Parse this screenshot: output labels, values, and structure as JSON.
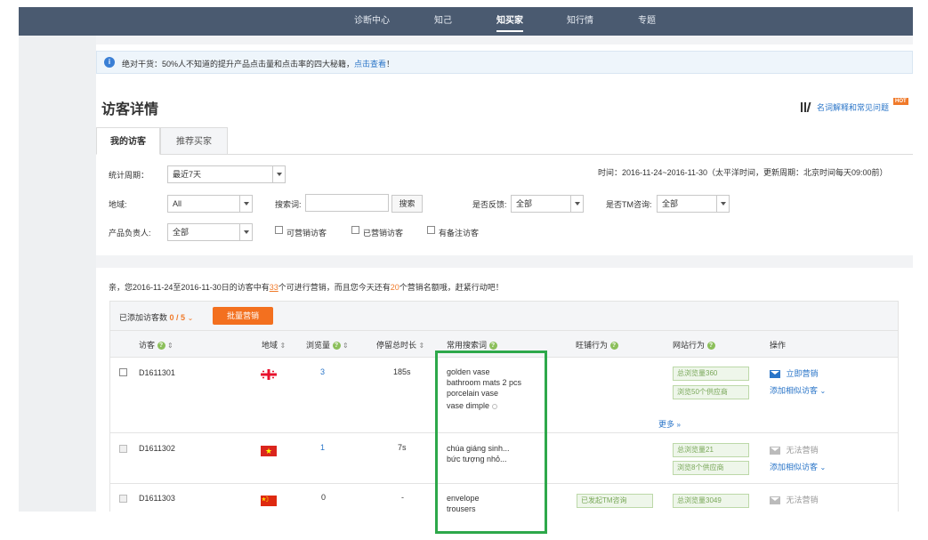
{
  "nav": {
    "items": [
      {
        "label": "诊断中心"
      },
      {
        "label": "知己"
      },
      {
        "label": "知买家",
        "active": true
      },
      {
        "label": "知行情"
      },
      {
        "label": "专题"
      }
    ]
  },
  "notice": {
    "icon": "info-icon",
    "text": "绝对干货：50%人不知道的提升产品点击量和点击率的四大秘籍，",
    "link": "点击查看",
    "suffix": "！"
  },
  "page": {
    "title": "访客详情",
    "help_label": "名词解释和常见问题",
    "hot_badge": "HOT"
  },
  "tabs": [
    {
      "label": "我的访客",
      "active": true
    },
    {
      "label": "推荐买家",
      "active": false
    }
  ],
  "filters": {
    "period_label": "统计周期：",
    "period_value": "最近7天",
    "time_text": "时间：2016-11-24~2016-11-30（太平洋时间，更新周期：北京时间每天09:00前）",
    "region_label": "地域:",
    "region_value": "All",
    "search_label": "搜索词:",
    "search_value": "",
    "search_button": "搜索",
    "feedback_label": "是否反馈:",
    "feedback_value": "全部",
    "tm_label": "是否TM咨询:",
    "tm_value": "全部",
    "owner_label": "产品负责人:",
    "owner_value": "全部",
    "checkbox_marketable": "可营销访客",
    "checkbox_marketed": "已营销访客",
    "checkbox_remark": "有备注访客"
  },
  "summary": {
    "prefix": "亲，您2016-11-24至2016-11-30日的访客中有",
    "count": "33",
    "middle": "个可进行营销，而且您今天还有",
    "quota": "20",
    "suffix": "个营销名额哦，赶紧行动吧！"
  },
  "toolbar": {
    "added_label": "已添加访客数",
    "added_count": "0 / 5",
    "batch_button": "批量营销"
  },
  "table": {
    "headers": {
      "visitor": "访客",
      "region": "地域",
      "views": "浏览量",
      "duration": "停留总时长",
      "keywords": "常用搜索词",
      "wangwang": "旺铺行为",
      "site": "网站行为",
      "actions": "操作"
    },
    "rows": [
      {
        "id": "D1611301",
        "views": "3",
        "duration": "185s",
        "keywords": [
          "golden vase",
          "bathroom mats 2 pcs",
          "porcelain vase",
          "vase dimple"
        ],
        "site_total": "总浏览量360",
        "site_suppliers": "浏览50个供应商",
        "action_primary": "立即营销",
        "action_similar": "添加相似访客",
        "more": "更多"
      },
      {
        "id": "D1611302",
        "views": "1",
        "duration": "7s",
        "keywords": [
          "chúa giáng sinh...",
          "bức tượng nhỏ..."
        ],
        "site_total": "总浏览量21",
        "site_suppliers": "浏览8个供应商",
        "action_primary": "无法营销",
        "action_similar": "添加相似访客"
      },
      {
        "id": "D1611303",
        "views": "0",
        "duration": "-",
        "keywords": [
          "envelope",
          "trousers"
        ],
        "wangwang": "已发起TM咨询",
        "site_total": "总浏览量3049",
        "action_primary": "无法营销"
      }
    ]
  },
  "colors": {
    "nav_bg": "#4a5a70",
    "accent_orange": "#f3701f",
    "link_blue": "#2a75c8",
    "highlight_green": "#2da84a"
  }
}
